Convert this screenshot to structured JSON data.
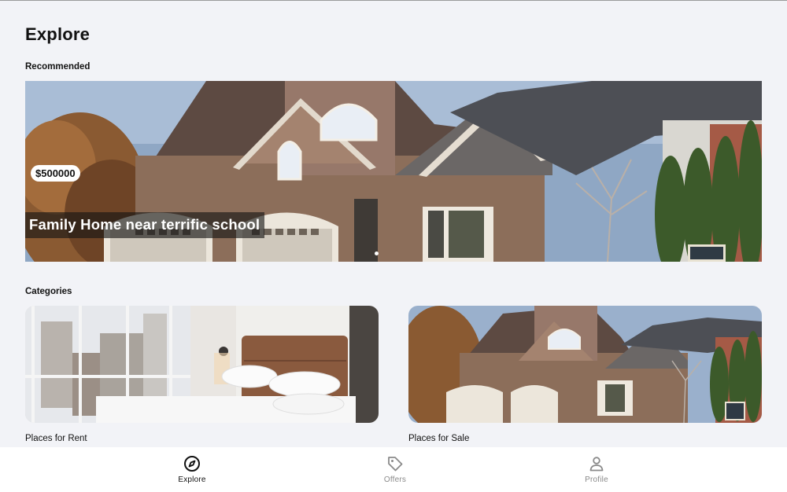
{
  "page": {
    "title": "Explore"
  },
  "recommended": {
    "section_label": "Recommended",
    "listing": {
      "title": "Family Home near terrific school",
      "price": "$500000"
    }
  },
  "categories": {
    "section_label": "Categories",
    "items": [
      {
        "label": "Places for Rent"
      },
      {
        "label": "Places for Sale"
      }
    ]
  },
  "bottom_nav": {
    "items": [
      {
        "label": "Explore",
        "icon": "compass-icon",
        "active": true
      },
      {
        "label": "Offers",
        "icon": "tag-icon",
        "active": false
      },
      {
        "label": "Profile",
        "icon": "person-icon",
        "active": false
      }
    ]
  },
  "colors": {
    "background": "#f2f3f7",
    "active": "#111111",
    "inactive": "#8a8a8a"
  }
}
